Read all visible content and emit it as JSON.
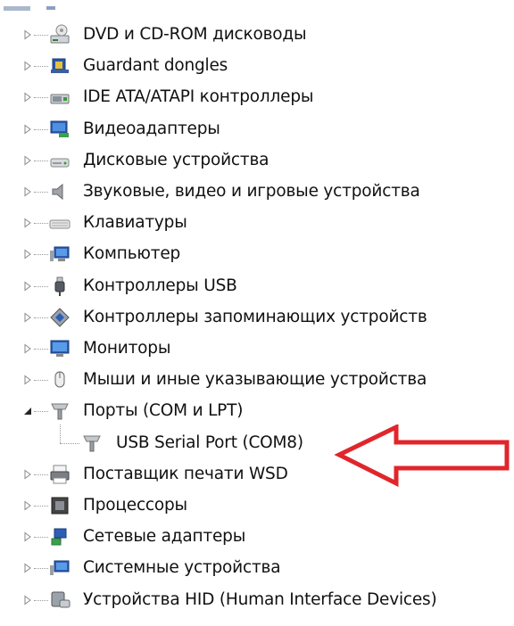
{
  "items": [
    {
      "label": "DVD и CD-ROM дисководы",
      "icon": "dvd-drive-icon",
      "expanded": false
    },
    {
      "label": "Guardant dongles",
      "icon": "dongle-icon",
      "expanded": false
    },
    {
      "label": "IDE ATA/ATAPI контроллеры",
      "icon": "ide-controller-icon",
      "expanded": false
    },
    {
      "label": "Видеоадаптеры",
      "icon": "display-adapter-icon",
      "expanded": false
    },
    {
      "label": "Дисковые устройства",
      "icon": "disk-drive-icon",
      "expanded": false
    },
    {
      "label": "Звуковые, видео и игровые устройства",
      "icon": "speaker-icon",
      "expanded": false
    },
    {
      "label": "Клавиатуры",
      "icon": "keyboard-icon",
      "expanded": false
    },
    {
      "label": "Компьютер",
      "icon": "computer-icon",
      "expanded": false
    },
    {
      "label": "Контроллеры USB",
      "icon": "usb-plug-icon",
      "expanded": false
    },
    {
      "label": "Контроллеры запоминающих устройств",
      "icon": "storage-controller-icon",
      "expanded": false
    },
    {
      "label": "Мониторы",
      "icon": "monitor-icon",
      "expanded": false
    },
    {
      "label": "Мыши и иные указывающие устройства",
      "icon": "mouse-icon",
      "expanded": false
    },
    {
      "label": "Порты (COM и LPT)",
      "icon": "port-icon",
      "expanded": true,
      "children": [
        {
          "label": "USB Serial Port (COM8)",
          "icon": "port-icon"
        }
      ]
    },
    {
      "label": "Поставщик печати WSD",
      "icon": "printer-icon",
      "expanded": false
    },
    {
      "label": "Процессоры",
      "icon": "processor-icon",
      "expanded": false
    },
    {
      "label": "Сетевые адаптеры",
      "icon": "network-adapter-icon",
      "expanded": false
    },
    {
      "label": "Системные устройства",
      "icon": "system-device-icon",
      "expanded": false
    },
    {
      "label": "Устройства HID (Human Interface Devices)",
      "icon": "hid-device-icon",
      "expanded": false
    }
  ],
  "annotation": {
    "type": "arrow",
    "color": "#e0262b",
    "points_to": "USB Serial Port (COM8)"
  }
}
